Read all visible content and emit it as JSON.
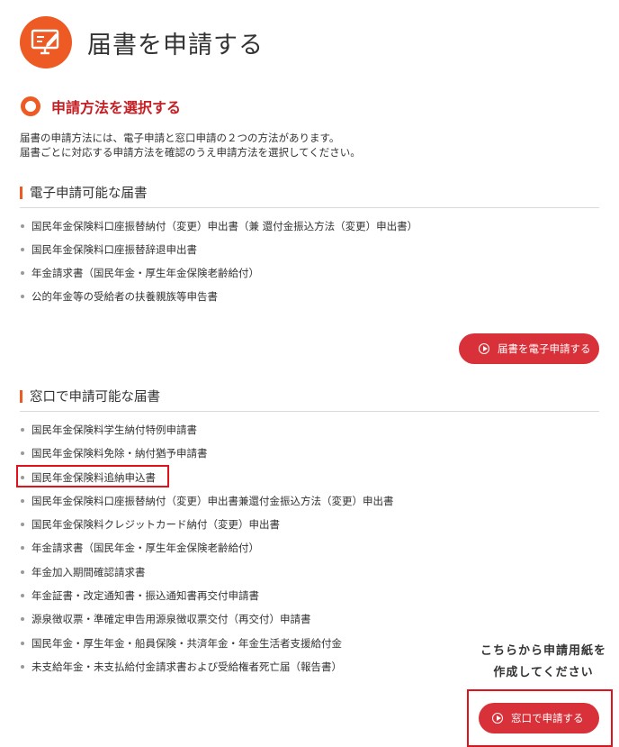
{
  "header": {
    "title": "届書を申請する",
    "icon": "monitor-pen-icon"
  },
  "section": {
    "title": "申請方法を選択する"
  },
  "intro": {
    "line1": "届書の申請方法には、電子申請と窓口申請の２つの方法があります。",
    "line2": "届書ごとに対応する申請方法を確認のうえ申請方法を選択してください。"
  },
  "electronic": {
    "title": "電子申請可能な届書",
    "items": [
      "国民年金保険料口座振替納付（変更）申出書（兼 還付金振込方法（変更）申出書）",
      "国民年金保険料口座振替辞退申出書",
      "年金請求書（国民年金・厚生年金保険老齢給付）",
      "公的年金等の受給者の扶養親族等申告書"
    ],
    "button_label": "届書を電子申請する"
  },
  "counter": {
    "title": "窓口で申請可能な届書",
    "items": [
      "国民年金保険料学生納付特例申請書",
      "国民年金保険料免除・納付猶予申請書",
      "国民年金保険料追納申込書",
      "国民年金保険料口座振替納付（変更）申出書兼還付金振込方法（変更）申出書",
      "国民年金保険料クレジットカード納付（変更）申出書",
      "年金請求書（国民年金・厚生年金保険老齢給付）",
      "年金加入期間確認請求書",
      "年金証書・改定通知書・振込通知書再交付申請書",
      "源泉徴収票・準確定申告用源泉徴収票交付（再交付）申請書",
      "国民年金・厚生年金・船員保険・共済年金・年金生活者支援給付金",
      "未支給年金・未支払給付金請求書および受給権者死亡届（報告書）"
    ],
    "button_label": "窓口で申請する"
  },
  "annotation": {
    "line1": "こちらから申請用紙を",
    "line2": "作成してください"
  },
  "colors": {
    "accent": "#ee5a24",
    "button": "#d8313a",
    "highlight": "#e0121b",
    "section_title": "#c42025"
  }
}
